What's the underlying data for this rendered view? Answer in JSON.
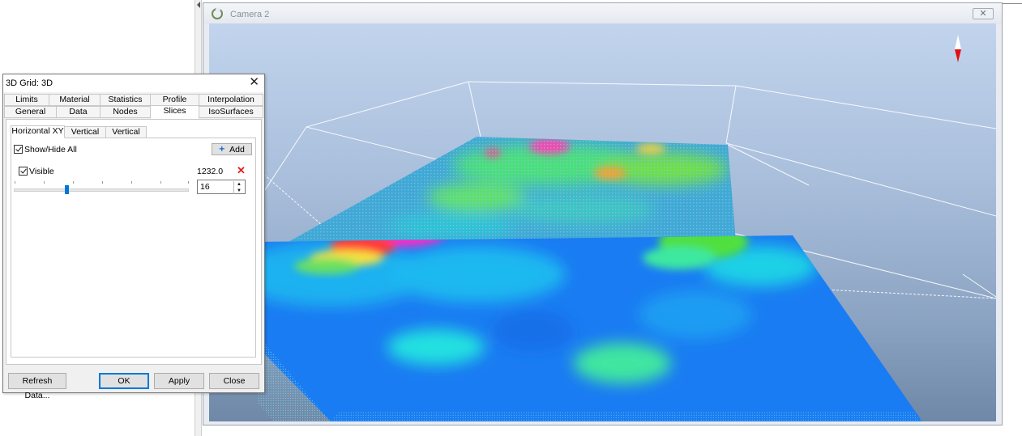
{
  "camera_window": {
    "title": "Camera 2",
    "close_glyph": "✕"
  },
  "dialog": {
    "title": "3D Grid: 3D",
    "close_glyph": "✕",
    "tabs_row1": [
      "Limits",
      "Material",
      "Statistics",
      "Profile",
      "Interpolation"
    ],
    "tabs_row2": [
      "General",
      "Data",
      "Nodes",
      "Slices",
      "IsoSurfaces"
    ],
    "active_tab": "Slices",
    "subtabs": [
      "Horizontal XY",
      "Vertical ZX",
      "Vertical ZY"
    ],
    "active_subtab": "Horizontal XY",
    "show_hide_all_label": "Show/Hide All",
    "show_hide_all_checked": true,
    "add_button_label": "Add",
    "slice": {
      "visible_label": "Visible",
      "visible_checked": true,
      "elevation": "1232.0",
      "index_value": "16",
      "slider_level": 0.3
    },
    "footer": {
      "refresh_label": "Refresh Data...",
      "ok_label": "OK",
      "apply_label": "Apply",
      "close_label": "Close"
    }
  },
  "colors": {
    "accent": "#0078d7",
    "delete": "#e02020",
    "north_red": "#e01010"
  },
  "icons": {
    "add": "plus-icon",
    "delete": "delete-x-icon",
    "camera_logo": "camera-logo-icon",
    "north_arrow": "north-arrow-icon"
  }
}
